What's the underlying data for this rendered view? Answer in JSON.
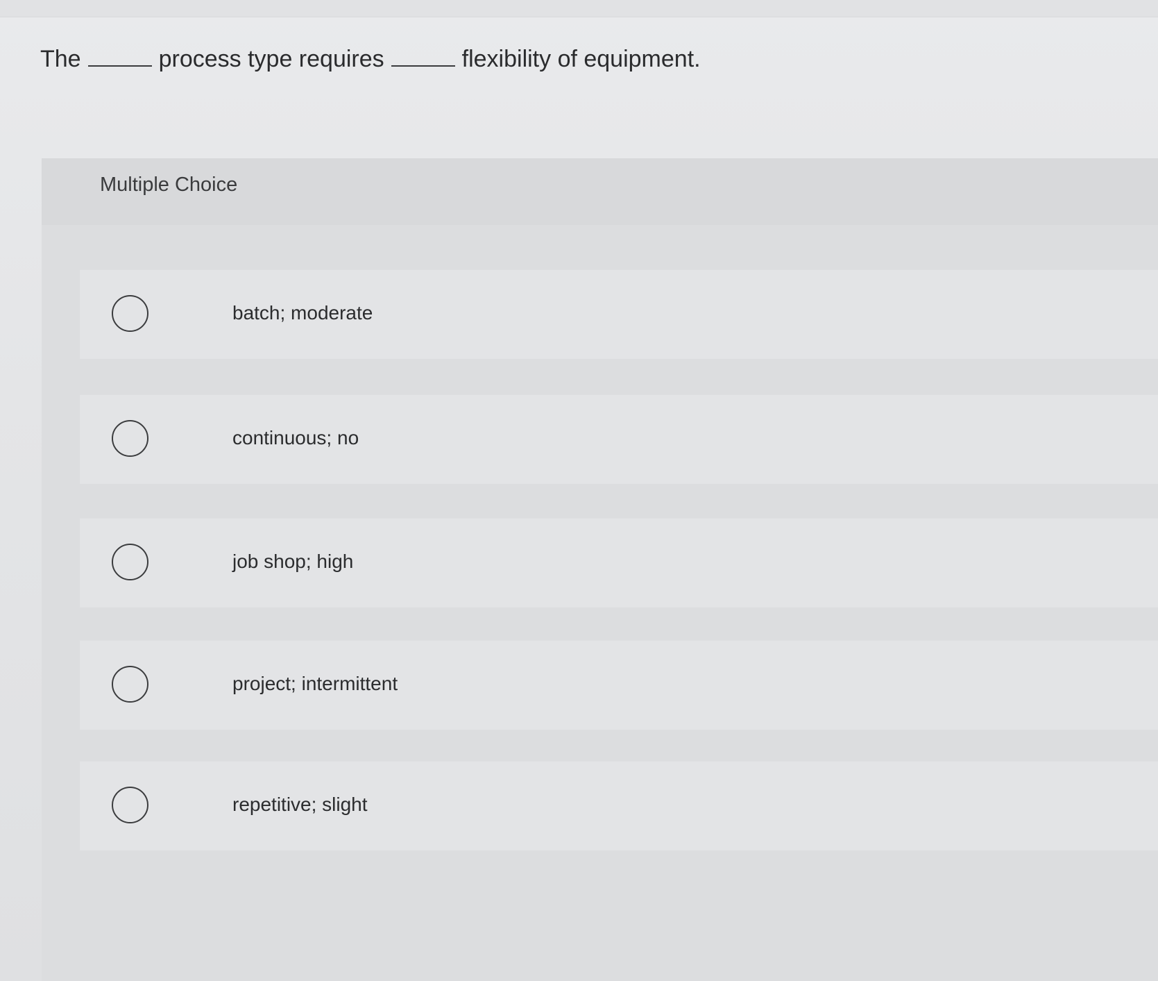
{
  "question": {
    "part1": "The",
    "part2": "process type requires",
    "part3": "flexibility of equipment."
  },
  "section_label": "Multiple Choice",
  "options": [
    {
      "label": "batch; moderate"
    },
    {
      "label": "continuous; no"
    },
    {
      "label": "job shop; high"
    },
    {
      "label": "project; intermittent"
    },
    {
      "label": "repetitive; slight"
    }
  ]
}
